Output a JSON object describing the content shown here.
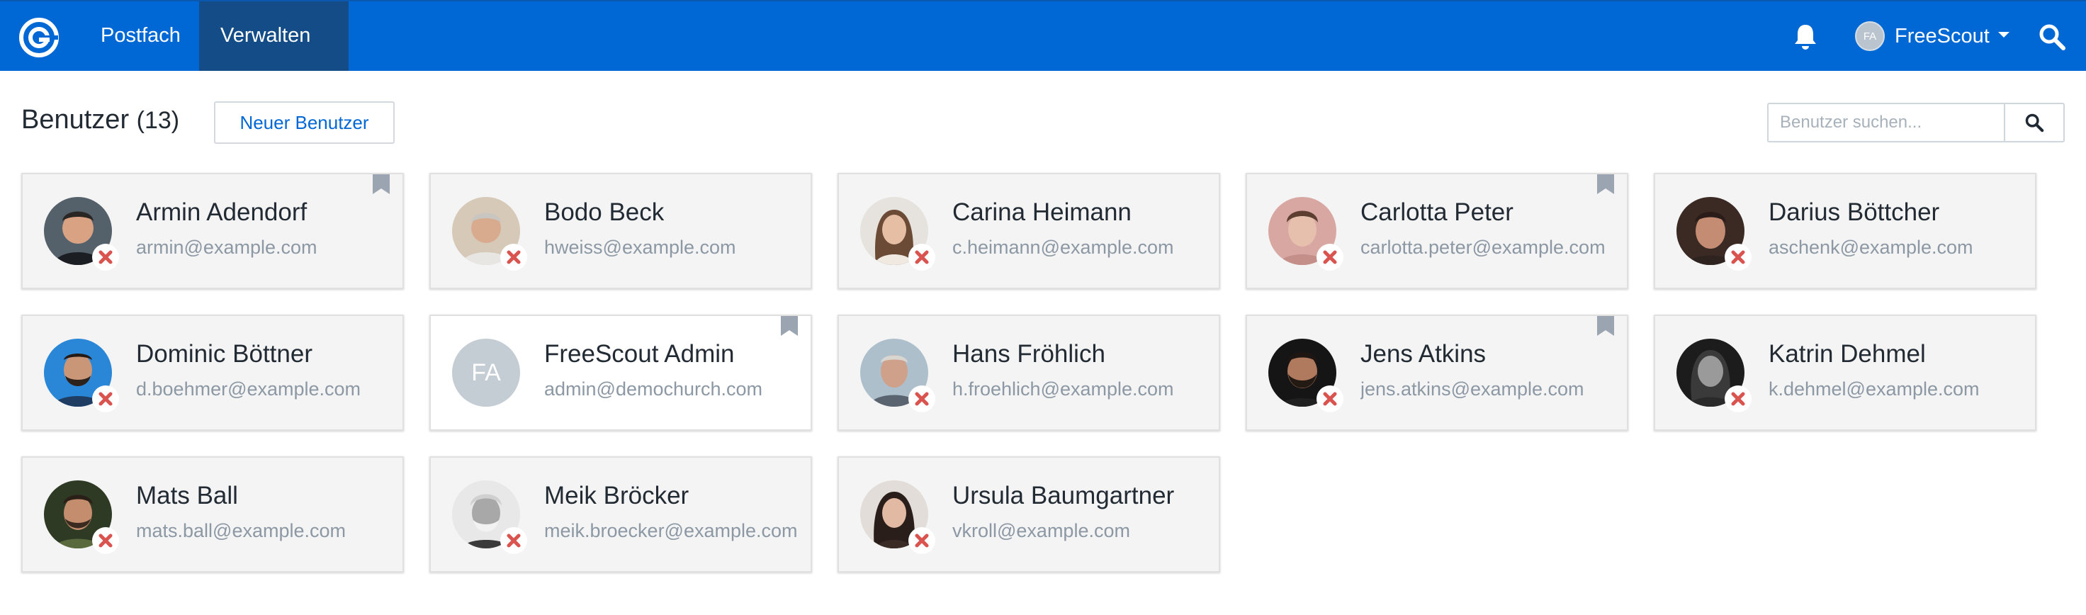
{
  "nav": {
    "brand_icon": "freescout-logo-icon",
    "items": [
      {
        "label": "Postfach"
      },
      {
        "label": "Verwalten"
      }
    ],
    "user": {
      "initials": "FA",
      "name": "FreeScout"
    },
    "colors": {
      "bar": "#0068d4",
      "active": "#134c86"
    }
  },
  "page": {
    "title": "Benutzer",
    "count": "(13)",
    "new_user_label": "Neuer Benutzer",
    "search_placeholder": "Benutzer suchen..."
  },
  "users": [
    {
      "name": "Armin Adendorf",
      "email": "armin@example.com",
      "bookmark": true,
      "status": "inactive",
      "photo": "dark-hair-man"
    },
    {
      "name": "Bodo Beck",
      "email": "hweiss@example.com",
      "bookmark": false,
      "status": "inactive",
      "photo": "grey-hair-man"
    },
    {
      "name": "Carina Heimann",
      "email": "c.heimann@example.com",
      "bookmark": false,
      "status": "inactive",
      "photo": "brown-hair-woman"
    },
    {
      "name": "Carlotta Peter",
      "email": "carlotta.peter@example.com",
      "bookmark": true,
      "status": "inactive",
      "photo": "short-hair-woman"
    },
    {
      "name": "Darius Böttcher",
      "email": "aschenk@example.com",
      "bookmark": false,
      "status": "inactive",
      "photo": "young-man"
    },
    {
      "name": "Dominic Böttner",
      "email": "d.boehmer@example.com",
      "bookmark": false,
      "status": "inactive",
      "photo": "bearded-man-blue"
    },
    {
      "name": "FreeScout Admin",
      "email": "admin@demochurch.com",
      "bookmark": true,
      "status": "none",
      "initials": "FA"
    },
    {
      "name": "Hans Fröhlich",
      "email": "h.froehlich@example.com",
      "bookmark": false,
      "status": "inactive",
      "photo": "old-man"
    },
    {
      "name": "Jens Atkins",
      "email": "jens.atkins@example.com",
      "bookmark": true,
      "status": "inactive",
      "photo": "smiling-bearded-man"
    },
    {
      "name": "Katrin Dehmel",
      "email": "k.dehmel@example.com",
      "bookmark": false,
      "status": "inactive",
      "photo": "bw-woman"
    },
    {
      "name": "Mats Ball",
      "email": "mats.ball@example.com",
      "bookmark": false,
      "status": "inactive",
      "photo": "green-shirt-man"
    },
    {
      "name": "Meik Bröcker",
      "email": "meik.broecker@example.com",
      "bookmark": false,
      "status": "inactive",
      "photo": "bw-old-man"
    },
    {
      "name": "Ursula Baumgartner",
      "email": "vkroll@example.com",
      "bookmark": false,
      "status": "inactive",
      "photo": "dark-hair-woman"
    }
  ]
}
